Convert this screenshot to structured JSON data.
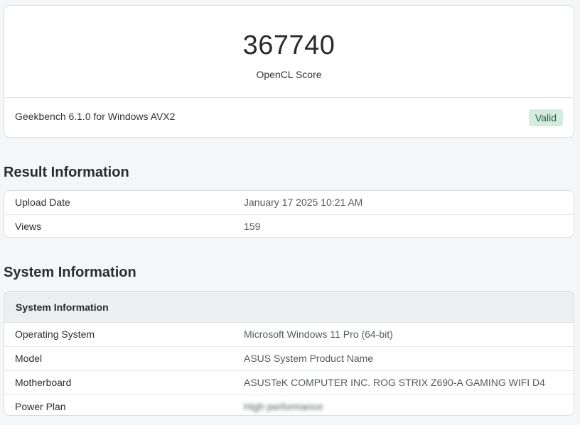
{
  "score": {
    "value": "367740",
    "label": "OpenCL Score",
    "version": "Geekbench 6.1.0 for Windows AVX2",
    "badge": "Valid"
  },
  "result_section": {
    "heading": "Result Information",
    "rows": [
      {
        "key": "Upload Date",
        "value": "January 17 2025 10:21 AM"
      },
      {
        "key": "Views",
        "value": "159"
      }
    ]
  },
  "system_section": {
    "heading": "System Information",
    "table_header": "System Information",
    "rows": [
      {
        "key": "Operating System",
        "value": "Microsoft Windows 11 Pro (64-bit)"
      },
      {
        "key": "Model",
        "value": "ASUS System Product Name"
      },
      {
        "key": "Motherboard",
        "value": "ASUSTeK COMPUTER INC. ROG STRIX Z690-A GAMING WIFI D4"
      },
      {
        "key": "Power Plan",
        "value": "High performance"
      }
    ]
  },
  "colors": {
    "valid_badge_bg": "#d4ecdf",
    "valid_badge_text": "#2c5e43",
    "page_bg": "#f5f6f7"
  }
}
